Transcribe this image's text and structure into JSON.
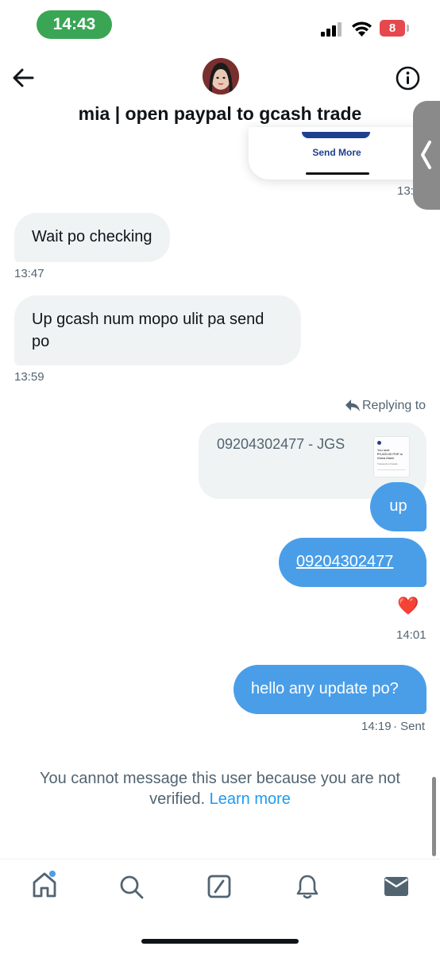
{
  "status_bar": {
    "time": "14:43",
    "battery": "8"
  },
  "header": {
    "title": "mia | open paypal to gcash trade"
  },
  "overlay": {
    "send_more": "Send More",
    "timestamp_partial": "13:"
  },
  "messages": [
    {
      "text": "Wait po checking",
      "time": "13:47"
    },
    {
      "text_line1": "Up gcash num mopo ulit pa send",
      "text_line2": "po",
      "time": "13:59"
    }
  ],
  "reply": {
    "label": "Replying to",
    "quoted": "09204302477 - JGS",
    "thumb_text_1": "You sent",
    "thumb_text_2": "₱3,000.00 PHP to",
    "thumb_text_3": "Kiana Mann",
    "thumb_text_4": "Transaction Details"
  },
  "outgoing": [
    {
      "text": "up"
    },
    {
      "text": "09204302477"
    }
  ],
  "reaction": "❤️",
  "outgoing_time": "14:01",
  "last_message": {
    "text": "hello any update po?",
    "time": "14:19",
    "status": "· Sent"
  },
  "notice": {
    "line1": "You cannot message this user because you are not",
    "line2_prefix": "verified. ",
    "link": "Learn more"
  },
  "nav": {
    "items": [
      "home-icon",
      "search-icon",
      "grok-icon",
      "bell-icon",
      "mail-icon"
    ]
  },
  "colors": {
    "accent": "#4a9ee8",
    "link": "#1d9bf0",
    "bubble_in": "#eff3f4",
    "status_green": "#3aa655",
    "battery_red": "#e5484d"
  }
}
